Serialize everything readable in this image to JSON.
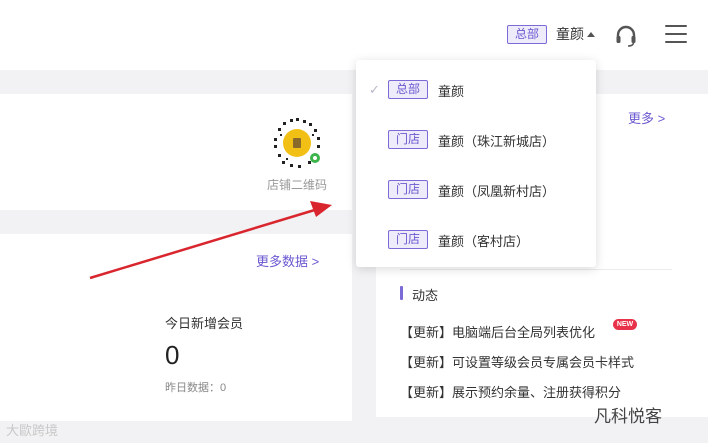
{
  "header": {
    "hq_badge": "总部",
    "user_name": "童颜"
  },
  "store_card": {
    "qr_label": "店铺二维码"
  },
  "data_card": {
    "more_label": "更多数据 >",
    "metric_title": "今日新增会员",
    "metric_value": "0",
    "metric_sub": "昨日数据：0"
  },
  "right_card": {
    "more_label": "更多 >",
    "news_title": "动态",
    "news": [
      "【更新】电脑端后台全局列表优化",
      "【更新】可设置等级会员专属会员卡样式",
      "【更新】展示预约余量、注册获得积分"
    ],
    "new_tag": "NEW"
  },
  "dropdown": {
    "check": "✓",
    "items": [
      {
        "badge": "总部",
        "name": "童颜"
      },
      {
        "badge": "门店",
        "name": "童颜（珠江新城店）"
      },
      {
        "badge": "门店",
        "name": "童颜（凤凰新村店）"
      },
      {
        "badge": "门店",
        "name": "童颜（客村店）"
      }
    ]
  },
  "watermarks": {
    "left": "大歐跨境",
    "right": "凡科悦客"
  },
  "colors": {
    "accent": "#6a58d0",
    "badge_bg": "#eeebfb",
    "arrow": "#d9262e",
    "new_tag": "#e8324a"
  }
}
